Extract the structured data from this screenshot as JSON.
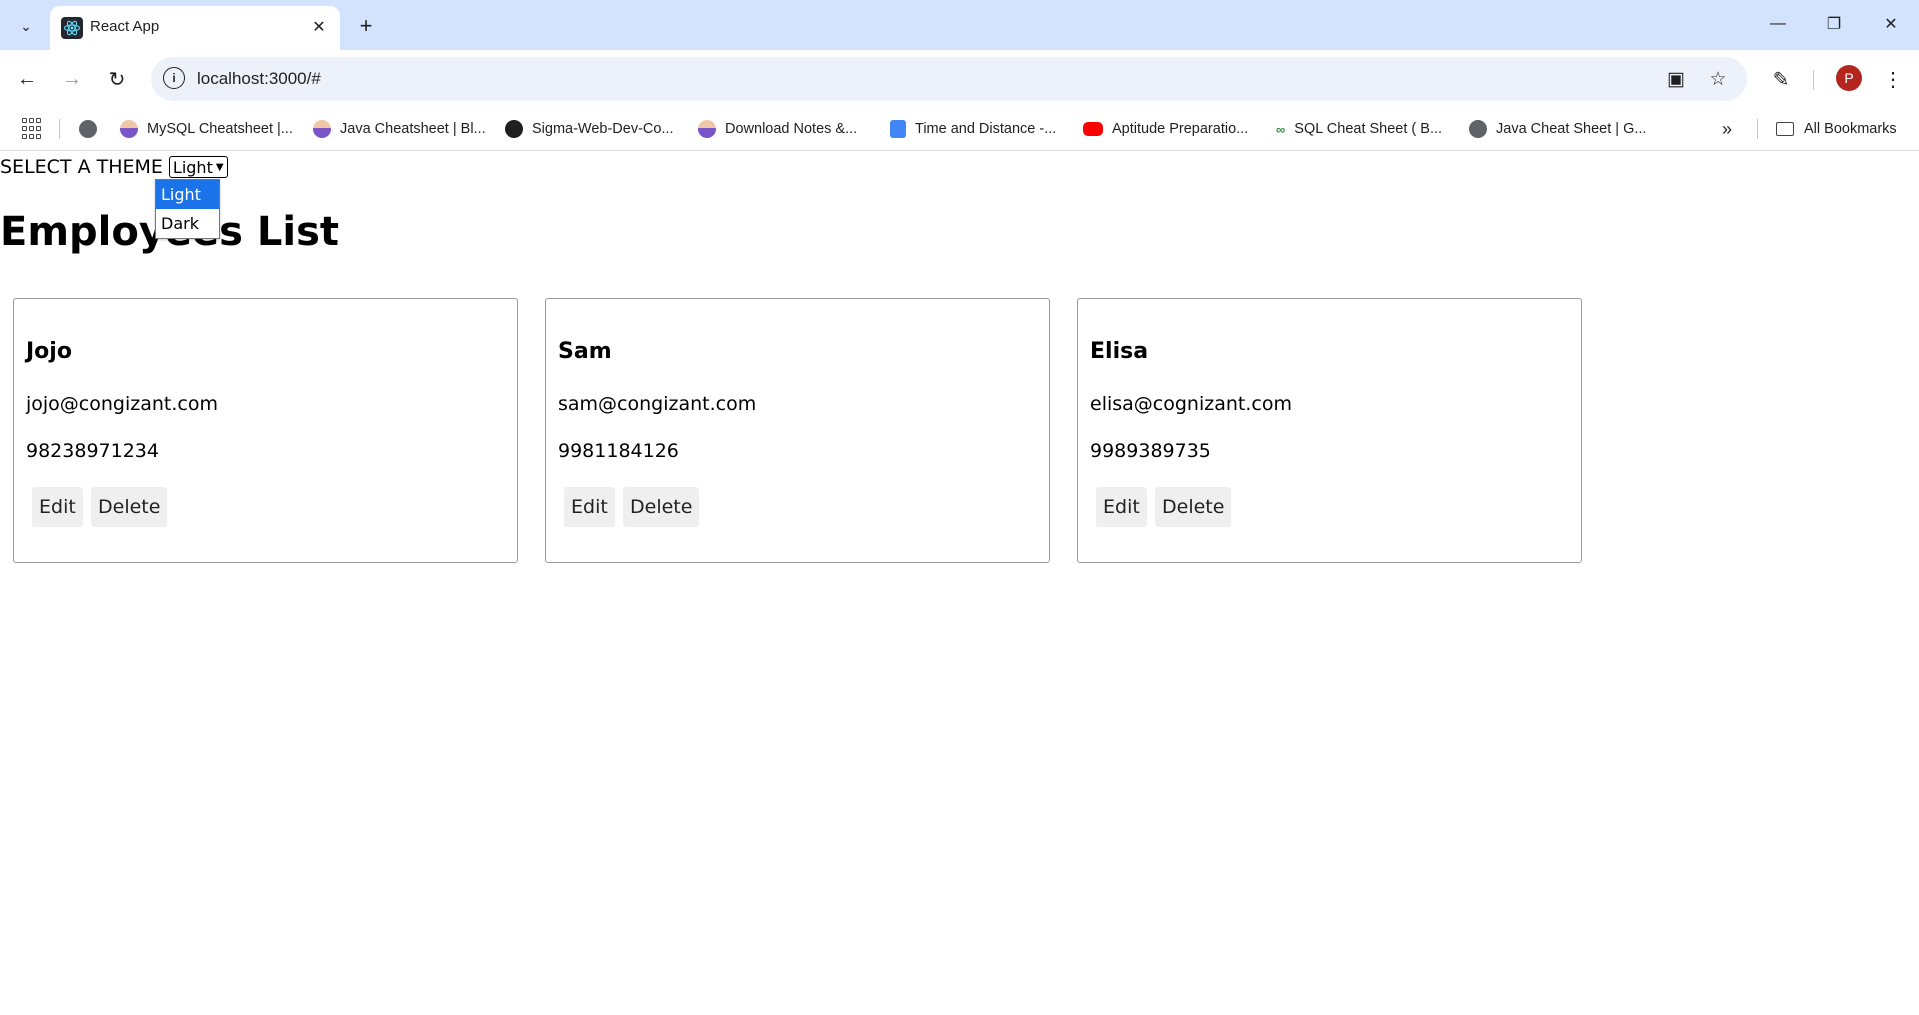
{
  "browser": {
    "tab_title": "React App",
    "url": "localhost:3000/#",
    "avatar_letter": "P",
    "bookmarks": [
      {
        "label": "MySQL Cheatsheet |...",
        "icon": "person-avatar-icon"
      },
      {
        "label": "Java Cheatsheet | Bl...",
        "icon": "person-avatar-icon"
      },
      {
        "label": "Sigma-Web-Dev-Co...",
        "icon": "github-icon"
      },
      {
        "label": "Download Notes &...",
        "icon": "person-avatar-icon"
      },
      {
        "label": "Time and Distance -...",
        "icon": "google-docs-icon"
      },
      {
        "label": "Aptitude Preparatio...",
        "icon": "youtube-icon"
      },
      {
        "label": "SQL Cheat Sheet ( B...",
        "icon": "geeksforgeeks-icon"
      },
      {
        "label": "Java Cheat Sheet | G...",
        "icon": "globe-icon"
      }
    ],
    "all_bookmarks_label": "All Bookmarks"
  },
  "page": {
    "theme_label": "SELECT A THEME",
    "theme_selected": "Light",
    "theme_options": [
      "Light",
      "Dark"
    ],
    "heading": "Employees List",
    "employees": [
      {
        "name": "Jojo",
        "email": "jojo@congizant.com",
        "phone": "98238971234"
      },
      {
        "name": "Sam",
        "email": "sam@congizant.com",
        "phone": "9981184126"
      },
      {
        "name": "Elisa",
        "email": "elisa@cognizant.com",
        "phone": "9989389735"
      }
    ],
    "edit_label": "Edit",
    "delete_label": "Delete"
  },
  "colors": {
    "tabstrip": "#d3e3fd",
    "omnibox": "#edf2fa",
    "selected_option": "#1a73e8",
    "avatar": "#b3261e"
  }
}
